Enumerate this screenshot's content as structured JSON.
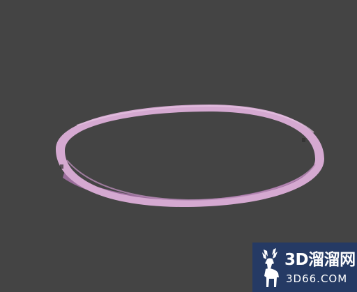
{
  "scene": {
    "background_color": "#444444",
    "object": "torus-ring",
    "object_color": "#d4a8d0",
    "object_shadow_color": "#9b6f9c"
  },
  "watermark": {
    "brand": "3D溜溜网",
    "domain": "3D66.COM",
    "logo_icon": "deer-icon",
    "background_color": "#233a67"
  }
}
